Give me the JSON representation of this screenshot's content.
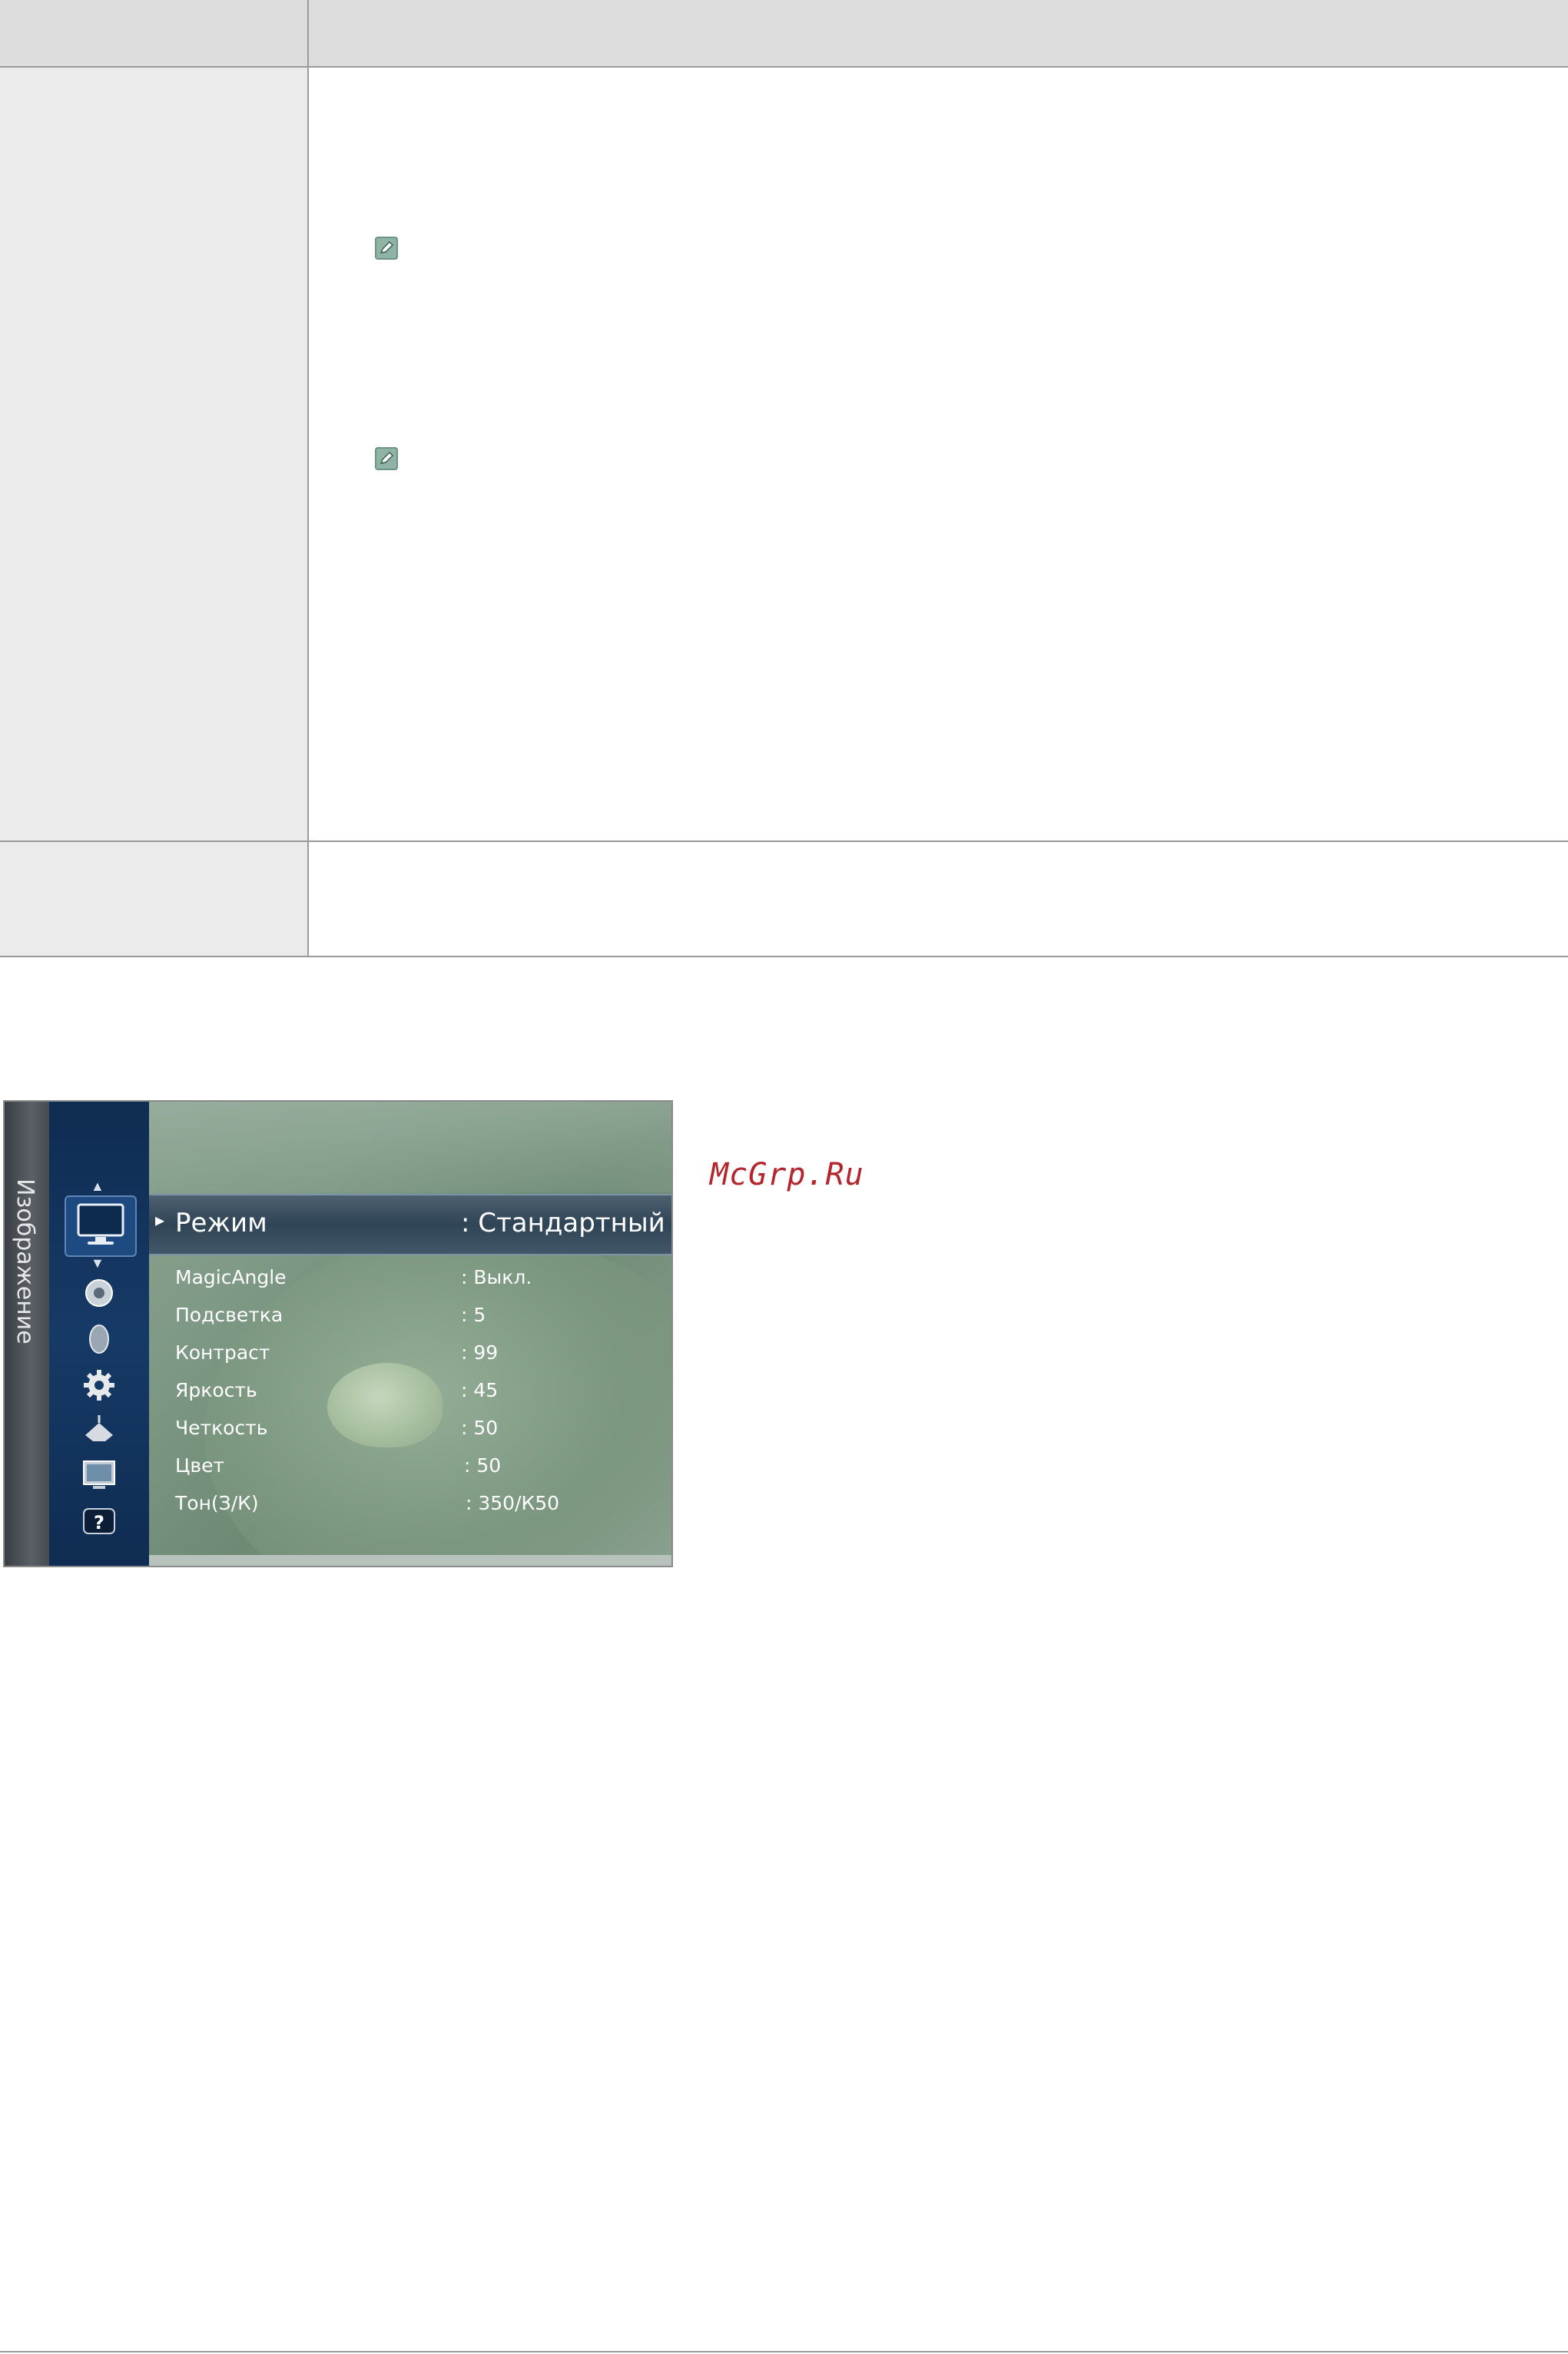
{
  "osd": {
    "section_label": "Изображение",
    "selected": {
      "label": "Режим",
      "value": ": Стандартный"
    },
    "rows": [
      {
        "label": "MagicAngle",
        "value": ": Выкл."
      },
      {
        "label": "Подсветка",
        "value": ": 5"
      },
      {
        "label": "Контраст",
        "value": ": 99"
      },
      {
        "label": "Яркость",
        "value": ": 45"
      },
      {
        "label": "Четкость",
        "value": ": 50"
      },
      {
        "label": "Цвет",
        "value": ": 50"
      },
      {
        "label": "Тон(З/К)",
        "value": ": 350/К50"
      }
    ],
    "icons": [
      "picture-icon",
      "sound-icon",
      "channel-icon",
      "setup-icon",
      "input-icon",
      "application-icon",
      "support-icon"
    ]
  },
  "watermark": "McGrp.Ru",
  "colors": {
    "header_bg": "#dcdcdc",
    "label_col_bg": "#ebebeb",
    "osd_nav": "#163a66",
    "watermark": "#b3262d"
  }
}
